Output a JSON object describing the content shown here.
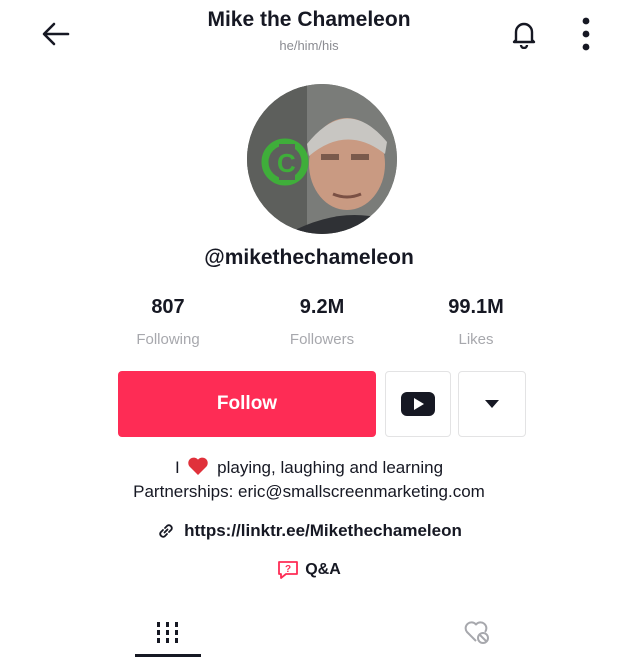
{
  "header": {
    "title": "Mike the Chameleon",
    "pronouns": "he/him/his",
    "back_icon": "arrow-left-icon",
    "bell_icon": "bell-icon",
    "more_icon": "more-vertical-icon"
  },
  "profile": {
    "username": "@mikethechameleon",
    "stats": [
      {
        "value": "807",
        "label": "Following"
      },
      {
        "value": "9.2M",
        "label": "Followers"
      },
      {
        "value": "99.1M",
        "label": "Likes"
      }
    ]
  },
  "actions": {
    "follow_label": "Follow",
    "follow_color": "#fe2c55",
    "youtube_icon": "youtube-icon",
    "dropdown_icon": "caret-down-icon"
  },
  "bio": {
    "line1_prefix": "I",
    "line1_suffix": "playing, laughing and learning",
    "line2": "Partnerships: eric@smallscreenmarketing.com",
    "link": "https://linktr.ee/Mikethechameleon",
    "qa_label": "Q&A"
  },
  "tabs": [
    {
      "icon": "grid-icon",
      "active": true
    },
    {
      "icon": "liked-videos-icon",
      "active": false
    }
  ]
}
